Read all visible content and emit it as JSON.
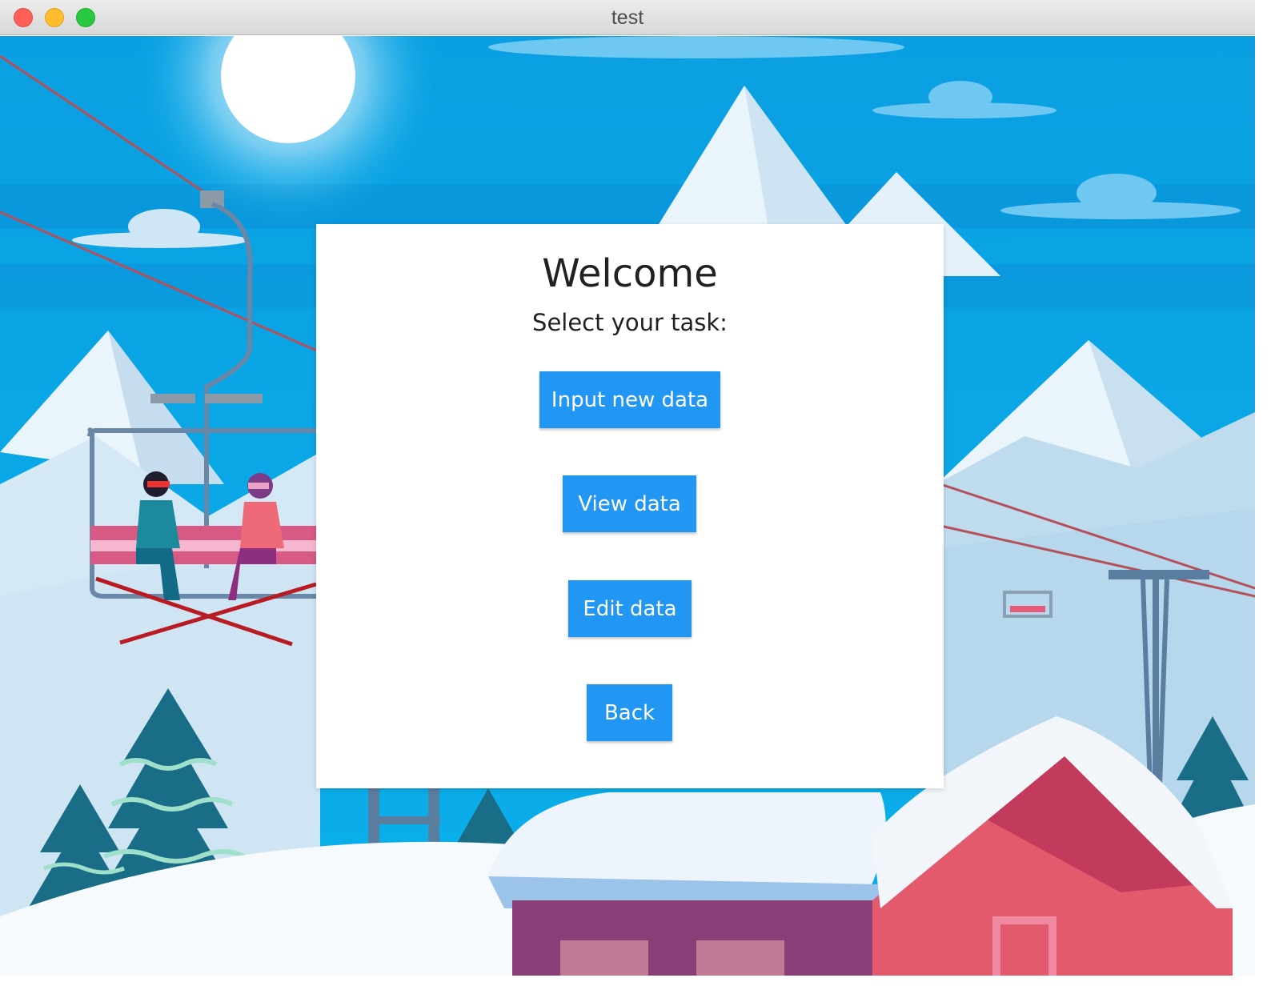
{
  "window": {
    "title": "test"
  },
  "welcome": {
    "heading": "Welcome",
    "subheading": "Select your task:"
  },
  "actions": {
    "input_new_data": "Input new data",
    "view_data": "View data",
    "edit_data": "Edit data",
    "back": "Back"
  },
  "colors": {
    "button": "#2196f3",
    "button_text": "#ffffff",
    "card": "#ffffff",
    "sky": "#0aa6e6"
  }
}
